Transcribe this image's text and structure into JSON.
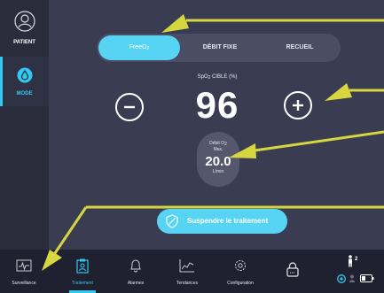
{
  "sidebar": {
    "patient_label": "PATIENT",
    "mode_label": "MODE"
  },
  "segments": [
    {
      "main": "FreeO",
      "sub": "2"
    },
    {
      "main": "DÉBIT FIXE",
      "sub": ""
    },
    {
      "main": "RECUEIL",
      "sub": ""
    }
  ],
  "target": {
    "label_prefix": "SpO",
    "label_sub": "2",
    "label_suffix": " CIBLE  (%)",
    "value": "96"
  },
  "flow": {
    "label_line1_prefix": "Débit O",
    "label_line1_sub": "2",
    "label_line2": "Max.",
    "value": "20.0",
    "unit": "L/min"
  },
  "suspend_label": "Suspendre le traitement",
  "tabs": [
    "Surveillance",
    "Traitement",
    "Alarmes",
    "Tendances",
    "Configuration"
  ],
  "status": {
    "count": "2"
  },
  "colors": {
    "accent": "#33c8f0",
    "annotation": "#d6d640"
  },
  "icons": [
    "person-icon",
    "drop-icon",
    "minus-icon",
    "plus-icon",
    "shield-icon",
    "monitor-icon",
    "clipboard-icon",
    "bell-icon",
    "chart-icon",
    "gear-icon",
    "lock-icon",
    "person-standing-icon",
    "battery-icon"
  ]
}
